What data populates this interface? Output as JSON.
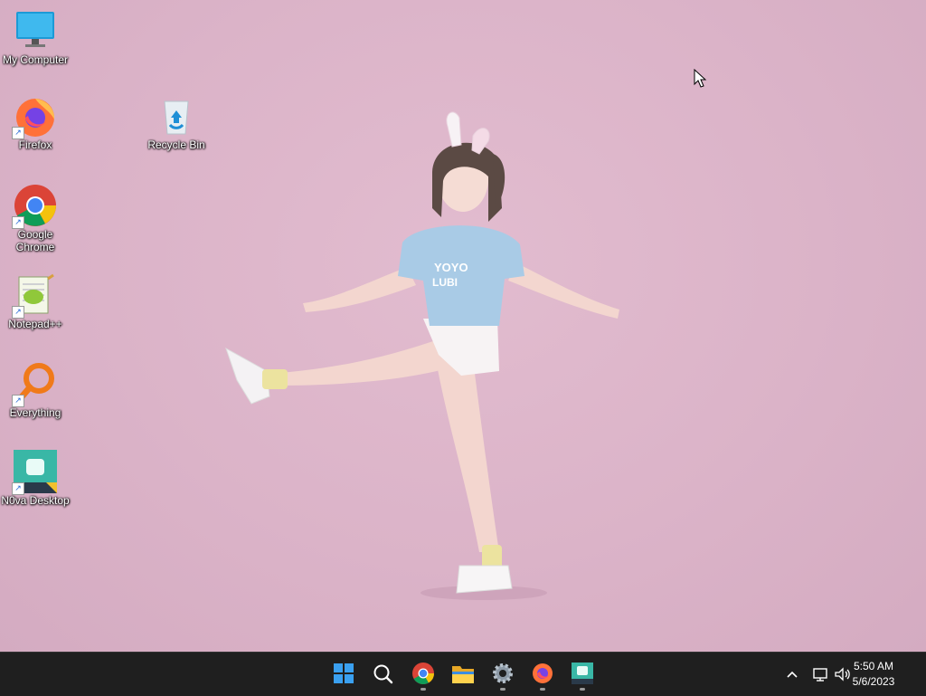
{
  "desktop": {
    "icons": [
      {
        "label": "My Computer"
      },
      {
        "label": "Firefox"
      },
      {
        "label": "Recycle Bin"
      },
      {
        "label": "Google Chrome"
      },
      {
        "label": "Notepad++"
      },
      {
        "label": "Everything"
      },
      {
        "label": "N0va Desktop"
      }
    ],
    "wallpaper_color": "#dcb4c9"
  },
  "taskbar": {
    "background": "#1f1f1f",
    "apps": [
      "start-icon",
      "search-icon",
      "chrome-icon",
      "file-explorer-icon",
      "settings-icon",
      "firefox-icon",
      "n0va-desktop-icon"
    ],
    "clock": {
      "time": "5:50 AM",
      "date": "5/6/2023"
    }
  }
}
